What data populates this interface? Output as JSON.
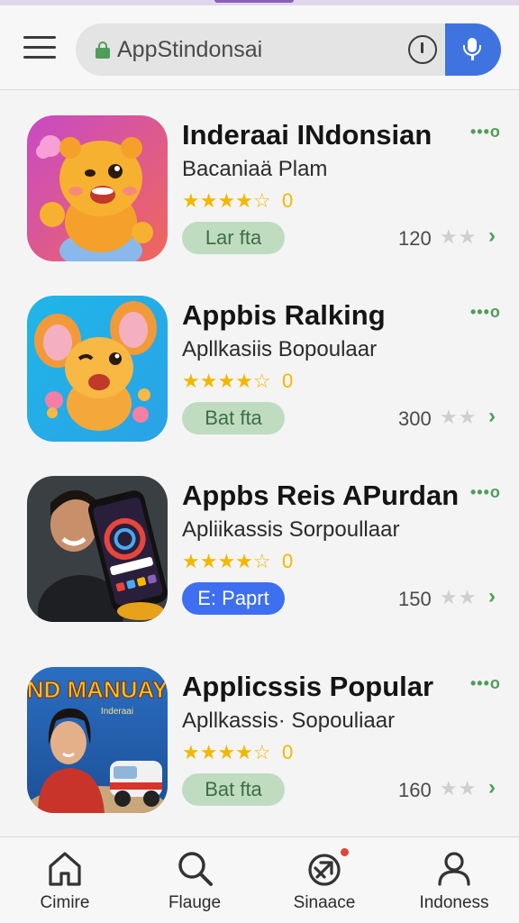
{
  "search": {
    "placeholder": "AppStindonsai"
  },
  "apps": [
    {
      "title": "Inderaai INdonsian",
      "subtitle": "Bacaniaä Plam",
      "stars": "★★★★☆",
      "rating": "0",
      "action": "Lar fta",
      "action_style": "green",
      "count": "120",
      "more": "•••o"
    },
    {
      "title": "Appbis Ralking",
      "subtitle": "Apllkasiis Bopoulaar",
      "stars": "★★★★☆",
      "rating": "0",
      "action": "Bat fta",
      "action_style": "green",
      "count": "300",
      "more": "•••o"
    },
    {
      "title": "Appbs Reis APurdan",
      "subtitle": "Apliikassis Sorpoullaar",
      "stars": "★★★★☆",
      "rating": "0",
      "action": "E: Paprt",
      "action_style": "blue",
      "count": "150",
      "more": "•••o"
    },
    {
      "title": "Applicssis Popular",
      "subtitle": "Apllkassis· Sopouliaar",
      "stars": "★★★★☆",
      "rating": "0",
      "action": "Bat fta",
      "action_style": "green",
      "count": "160",
      "more": "•••o"
    }
  ],
  "icon_banner": {
    "line1": "ND MANUAY",
    "line2": "Inderaai"
  },
  "nav": [
    {
      "label": "Cimire",
      "icon": "home-icon"
    },
    {
      "label": "Flauge",
      "icon": "search-icon"
    },
    {
      "label": "Sinaace",
      "icon": "apps-icon"
    },
    {
      "label": "Indoness",
      "icon": "profile-icon"
    }
  ],
  "colors": {
    "accent": "#3f73e0",
    "green": "#4f9e57",
    "star": "#f2b800",
    "pill_green": "#bfdcc0"
  }
}
